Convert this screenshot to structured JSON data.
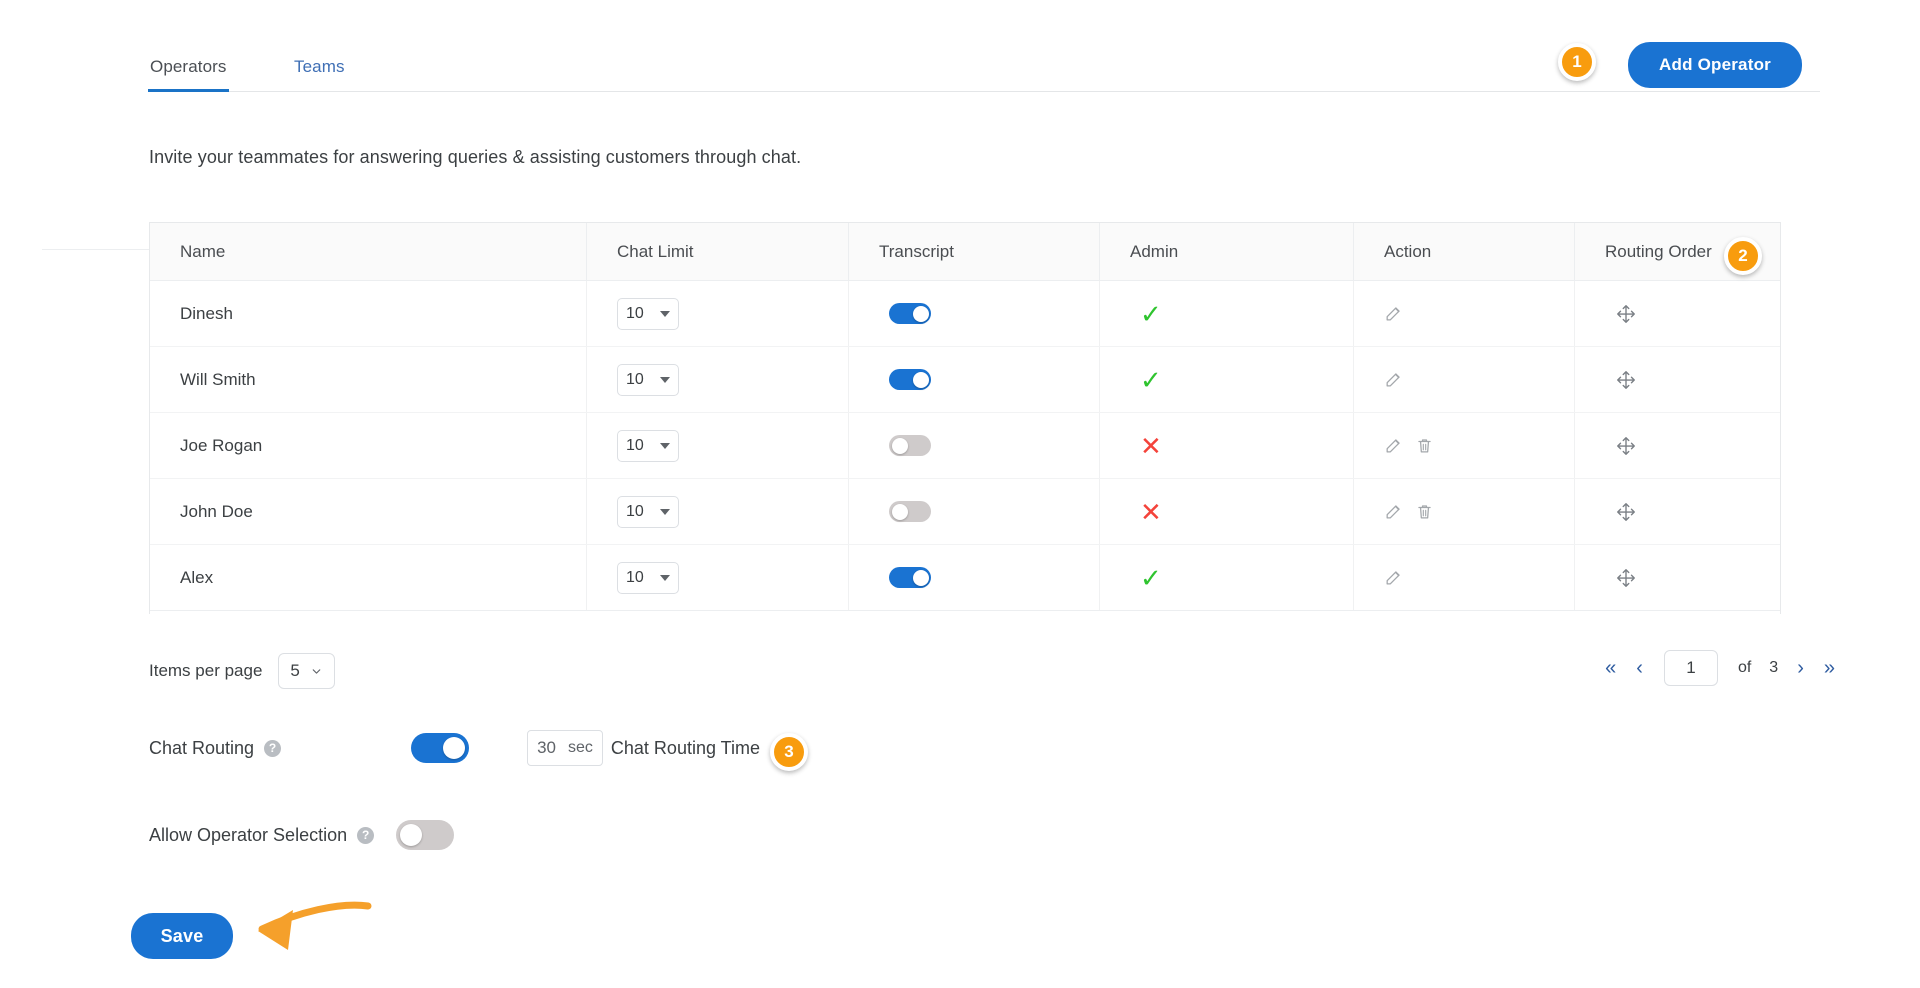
{
  "tabs": [
    {
      "label": "Operators",
      "active": true
    },
    {
      "label": "Teams",
      "active": false
    }
  ],
  "header": {
    "add_operator_label": "Add Operator",
    "marker_1": "1"
  },
  "subtitle": "Invite your teammates for answering queries & assisting customers through chat.",
  "table": {
    "marker_2": "2",
    "columns": [
      "Name",
      "Chat Limit",
      "Transcript",
      "Admin",
      "Action",
      "Routing Order"
    ],
    "rows": [
      {
        "name": "Dinesh",
        "chat_limit": "10",
        "transcript": true,
        "admin": true,
        "admin_mark": "✓",
        "actions": [
          "edit"
        ],
        "routing_handle": "drag-handle"
      },
      {
        "name": "Will Smith",
        "chat_limit": "10",
        "transcript": true,
        "admin": true,
        "admin_mark": "✓",
        "actions": [
          "edit"
        ],
        "routing_handle": "drag-handle"
      },
      {
        "name": "Joe Rogan",
        "chat_limit": "10",
        "transcript": false,
        "admin": false,
        "admin_mark": "✕",
        "actions": [
          "edit",
          "delete"
        ],
        "routing_handle": "drag-handle"
      },
      {
        "name": "John Doe",
        "chat_limit": "10",
        "transcript": false,
        "admin": false,
        "admin_mark": "✕",
        "actions": [
          "edit",
          "delete"
        ],
        "routing_handle": "drag-handle"
      },
      {
        "name": "Alex",
        "chat_limit": "10",
        "transcript": true,
        "admin": true,
        "admin_mark": "✓",
        "actions": [
          "edit"
        ],
        "routing_handle": "drag-handle"
      }
    ]
  },
  "pagination": {
    "items_per_page_label": "Items per page",
    "items_per_page_value": "5",
    "current_page": "1",
    "of_label": "of",
    "total_pages": "3",
    "first_icon": "«",
    "prev_icon": "‹",
    "next_icon": "›",
    "last_icon": "»"
  },
  "settings": {
    "chat_routing_label": "Chat Routing",
    "chat_routing_on": true,
    "chat_routing_time_value": "30",
    "chat_routing_time_unit": "sec",
    "chat_routing_time_label": "Chat Routing Time",
    "marker_3": "3",
    "allow_operator_selection_label": "Allow Operator Selection",
    "allow_operator_selection_on": false,
    "help_glyph": "?"
  },
  "footer": {
    "save_label": "Save"
  },
  "colors": {
    "primary_blue": "#1a73d2",
    "marker_orange": "#f89c0e",
    "check_green": "#2fc42f",
    "cross_red": "#f4433b",
    "tab_active": "#1a73c7",
    "arrow_orange": "#f5a02b"
  }
}
